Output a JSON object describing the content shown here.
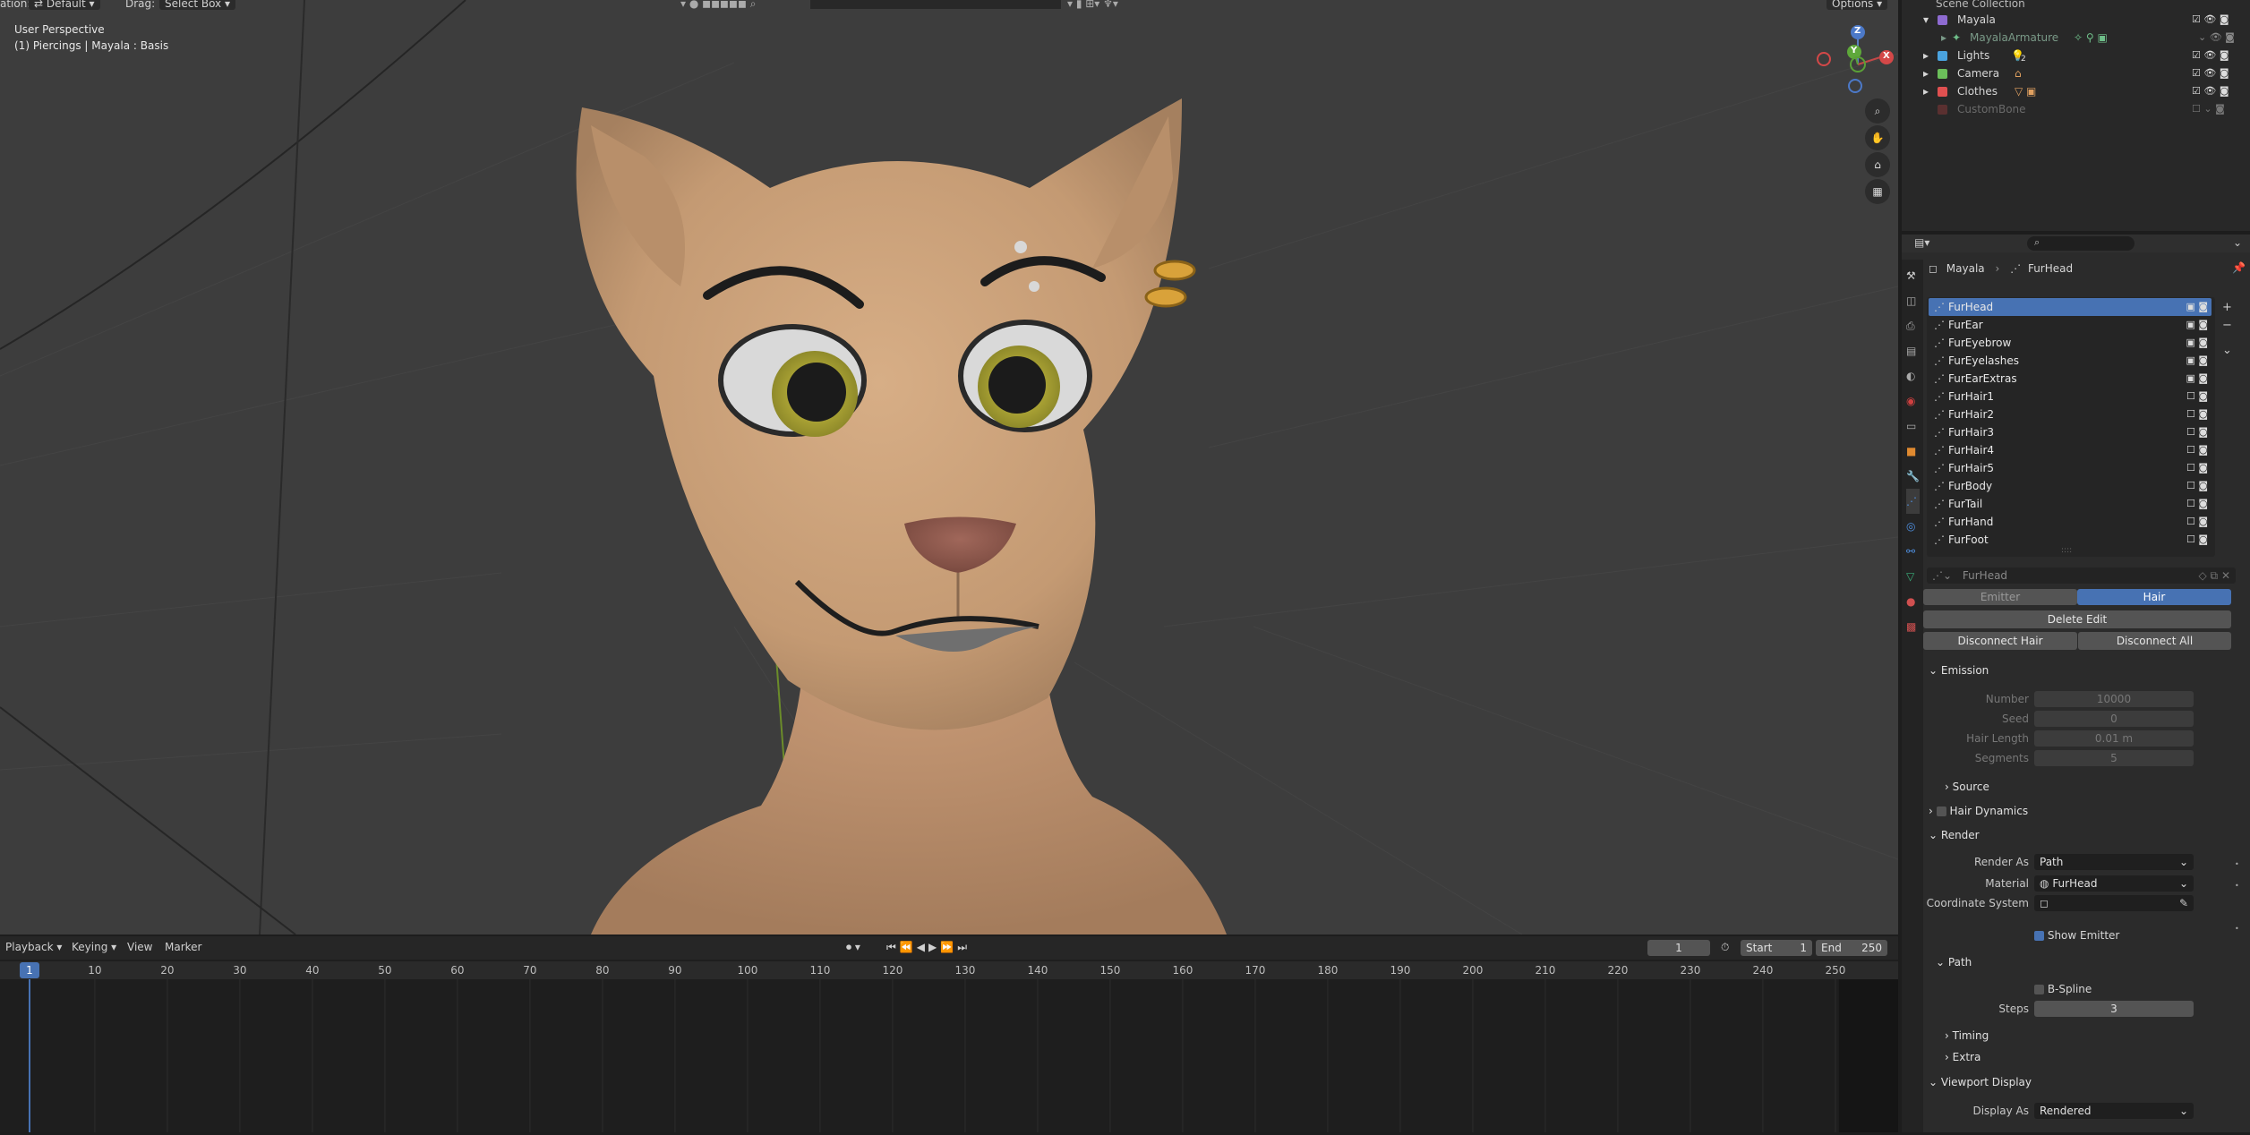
{
  "viewport": {
    "header": {
      "orientation_label": "ation:",
      "orientation_value": "Default",
      "drag_label": "Drag:",
      "drag_value": "Select Box",
      "options_label": "Options"
    },
    "info_line1": "User Perspective",
    "info_line2": "(1) Piercings | Mayala : Basis",
    "gizmo_labels": {
      "z": "Z",
      "y": "Y",
      "x": "X"
    }
  },
  "outliner": {
    "root": "Scene Collection",
    "items": [
      {
        "label": "Mayala",
        "color": "#8e6bd1"
      },
      {
        "label": "MayalaArmature",
        "color": "#5a8a6e"
      },
      {
        "label": "Lights",
        "color": "#4aa3df"
      },
      {
        "label": "Camera",
        "color": "#6bbf5a"
      },
      {
        "label": "Clothes",
        "color": "#e05050"
      },
      {
        "label": "CustomBone",
        "color": "#aa4444"
      }
    ],
    "badge_lights": "2"
  },
  "properties": {
    "breadcrumb": {
      "object": "Mayala",
      "system": "FurHead"
    },
    "systems": [
      "FurHead",
      "FurEar",
      "FurEyebrow",
      "FurEyelashes",
      "FurEarExtras",
      "FurHair1",
      "FurHair2",
      "FurHair3",
      "FurHair4",
      "FurHair5",
      "FurBody",
      "FurTail",
      "FurHand",
      "FurFoot"
    ],
    "settings_name": "FurHead",
    "tabs": {
      "emitter": "Emitter",
      "hair": "Hair"
    },
    "buttons": {
      "delete_edit": "Delete Edit",
      "disconnect_hair": "Disconnect Hair",
      "disconnect_all": "Disconnect All"
    },
    "emission": {
      "title": "Emission",
      "number_label": "Number",
      "number_value": "10000",
      "seed_label": "Seed",
      "seed_value": "0",
      "hair_length_label": "Hair Length",
      "hair_length_value": "0.01 m",
      "segments_label": "Segments",
      "segments_value": "5",
      "source": "Source"
    },
    "hair_dynamics": "Hair Dynamics",
    "render": {
      "title": "Render",
      "render_as_label": "Render As",
      "render_as_value": "Path",
      "material_label": "Material",
      "material_value": "FurHead",
      "coord_label": "Coordinate System",
      "show_emitter": "Show Emitter",
      "path_title": "Path",
      "bspline": "B-Spline",
      "steps_label": "Steps",
      "steps_value": "3",
      "timing": "Timing",
      "extra": "Extra"
    },
    "viewport_display": {
      "title": "Viewport Display",
      "display_as_label": "Display As",
      "display_as_value": "Rendered"
    }
  },
  "timeline": {
    "menus": [
      "Playback",
      "Keying",
      "View",
      "Marker"
    ],
    "current_frame": "1",
    "start_label": "Start",
    "start_value": "1",
    "end_label": "End",
    "end_value": "250",
    "ticks": [
      "1",
      "10",
      "20",
      "30",
      "40",
      "50",
      "60",
      "70",
      "80",
      "90",
      "100",
      "110",
      "120",
      "130",
      "140",
      "150",
      "160",
      "170",
      "180",
      "190",
      "200",
      "210",
      "220",
      "230",
      "240",
      "250"
    ],
    "playhead_frame": "1"
  },
  "colors": {
    "accent": "#4772b3",
    "selected_row": "#4772b3",
    "fur": "#c9a07a"
  }
}
